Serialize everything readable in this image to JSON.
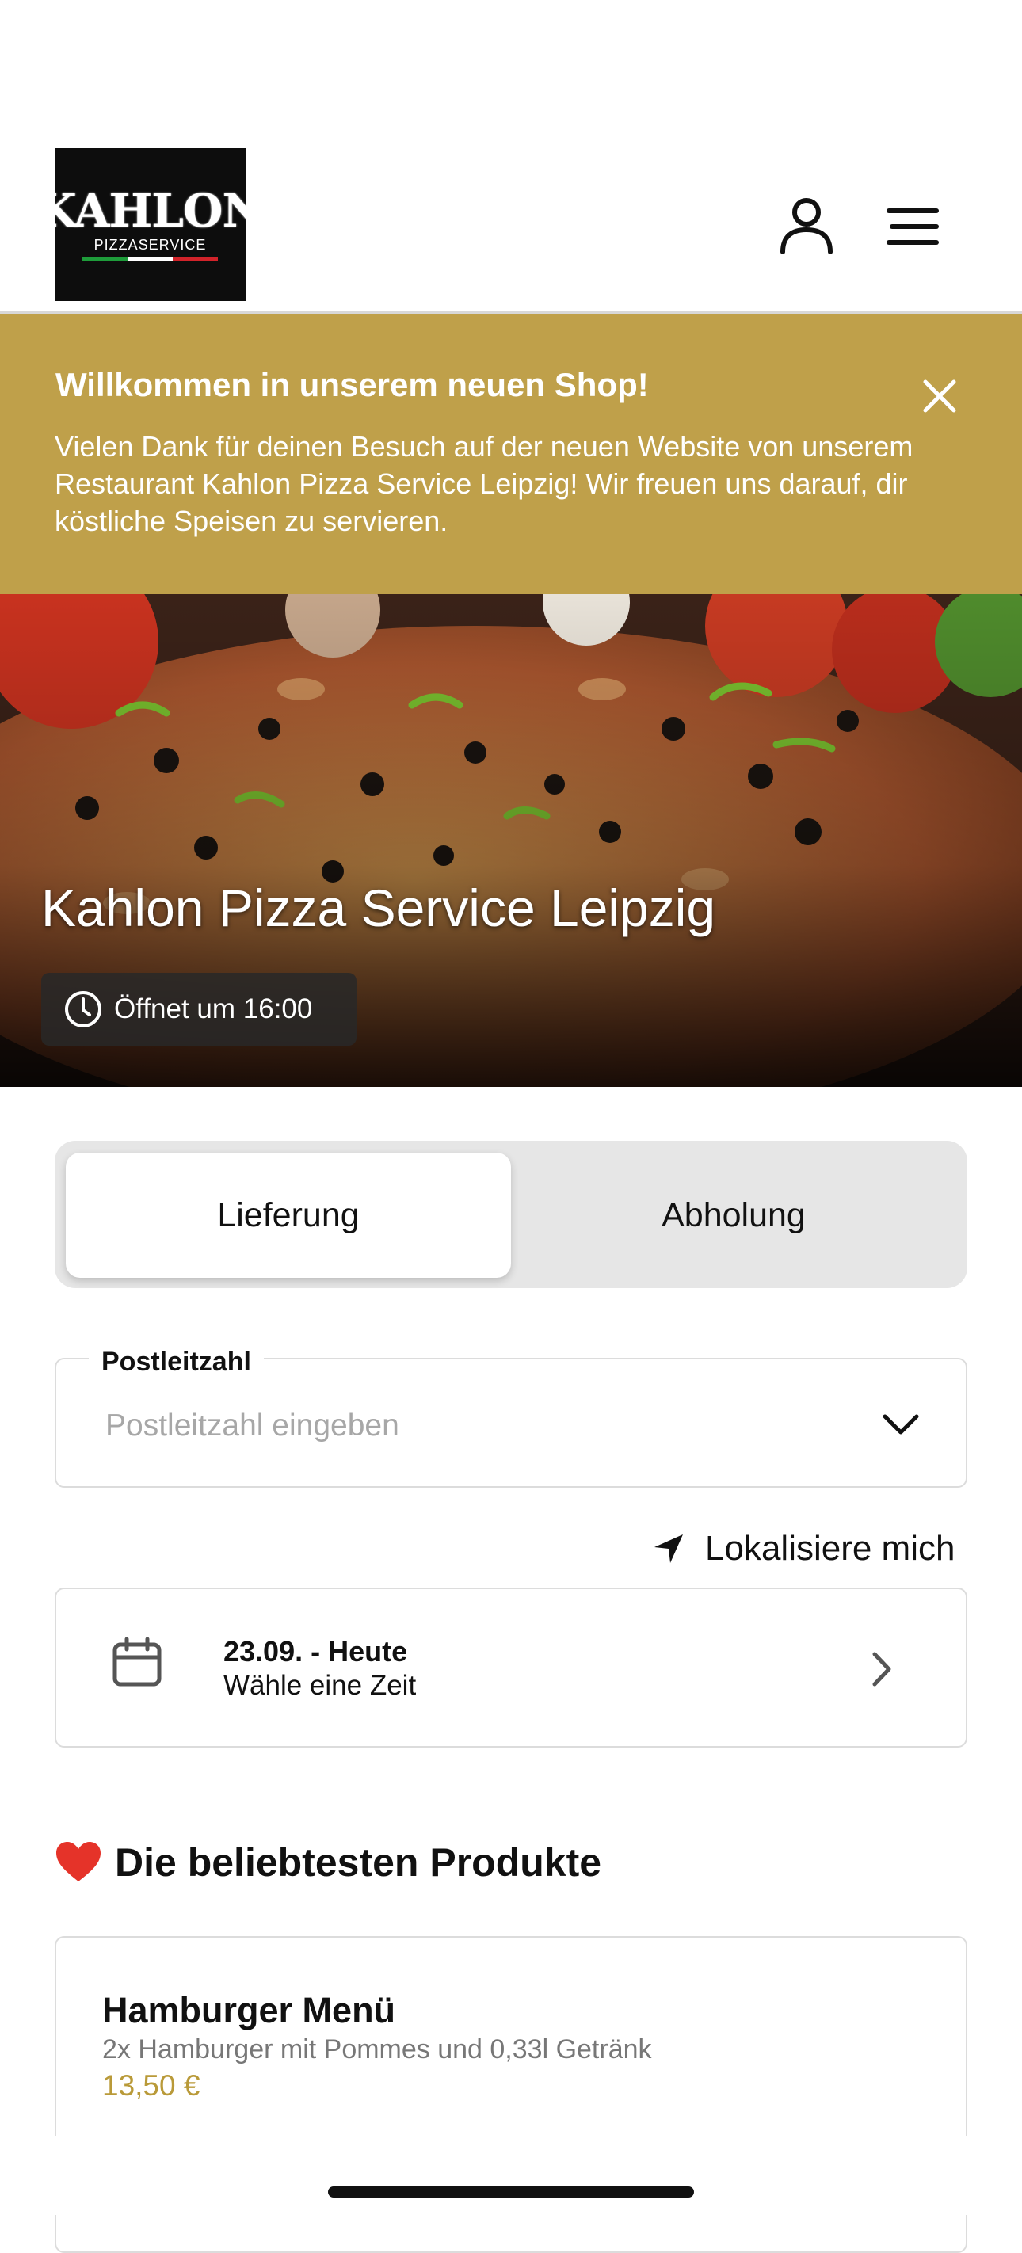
{
  "header": {
    "logo_brand": "KAHLON",
    "logo_sub": "PIZZASERVICE",
    "user_icon": "user-icon",
    "menu_icon": "hamburger-menu-icon"
  },
  "banner": {
    "title": "Willkommen in unserem neuen Shop!",
    "text": "Vielen Dank für deinen Besuch auf der neuen Website von unserem Restaurant Kahlon Pizza Service Leipzig! Wir freuen uns darauf, dir köstliche Speisen zu servieren.",
    "close_icon": "close-icon",
    "background": "#bfa04a"
  },
  "hero": {
    "title": "Kahlon Pizza Service Leipzig",
    "hours": "Öffnet um 16:00",
    "hours_icon": "clock-icon"
  },
  "tabs": [
    {
      "label": "Lieferung",
      "selected": true
    },
    {
      "label": "Abholung",
      "selected": false
    }
  ],
  "postcode": {
    "label": "Postleitzahl",
    "placeholder": "Postleitzahl eingeben",
    "icon": "chevron-down-icon"
  },
  "locate": {
    "label": "Lokalisiere mich",
    "icon": "location-arrow-icon"
  },
  "date": {
    "title": "23.09. - Heute",
    "subtitle": "Wähle eine Zeit",
    "icon": "calendar-icon",
    "chevron": "chevron-right-icon"
  },
  "products": {
    "heading": "Die beliebtesten Produkte",
    "heading_icon": "heart-icon",
    "items": [
      {
        "name": "Hamburger Menü",
        "description": "2x Hamburger mit Pommes und 0,33l Getränk",
        "price": "13,50 €"
      }
    ]
  },
  "colors": {
    "accent": "#bfa04a",
    "price": "#b99a39"
  }
}
